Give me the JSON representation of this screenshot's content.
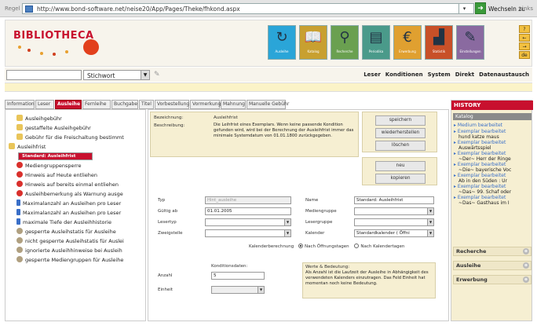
{
  "addressbar": {
    "label": "Regel",
    "url": "http://www.bond-software.net/neise20/App/Pages/Theke/fhkond.aspx",
    "go_label": "Wechseln zu",
    "links_label": "Links"
  },
  "header": {
    "logo_text": "BIBLIOTHECA",
    "toolbar_icons": [
      {
        "name": "refresh-icon",
        "glyph": "↻",
        "color": "#2aa5d8",
        "caption": "Ausleihe"
      },
      {
        "name": "book-icon",
        "glyph": "📖",
        "color": "#c8a030",
        "caption": "Katalog"
      },
      {
        "name": "search-icon",
        "glyph": "⚲",
        "color": "#6aa050",
        "caption": "Recherche"
      },
      {
        "name": "newspaper-icon",
        "glyph": "▤",
        "color": "#4a9a8a",
        "caption": "Periodika"
      },
      {
        "name": "euro-icon",
        "glyph": "€",
        "color": "#e0a030",
        "caption": "Erwerbung"
      },
      {
        "name": "chart-icon",
        "glyph": "▟",
        "color": "#c85028",
        "caption": "Statistik"
      },
      {
        "name": "wrench-icon",
        "glyph": "✎",
        "color": "#8a6aa0",
        "caption": "Einstellungen"
      }
    ],
    "right_mini": [
      "?",
      "←",
      "→",
      "de"
    ]
  },
  "search": {
    "select_value": "Stichwort",
    "input_value": ""
  },
  "menu": [
    "Leser",
    "Konditionen",
    "System",
    "Direkt",
    "Datenaustausch"
  ],
  "tabs": [
    "Information",
    "Leser",
    "Ausleihe",
    "Fernleihe",
    "Buchgabe",
    "Titel",
    "Vorbestellung",
    "Vormerkung",
    "Mahnung",
    "Manuelle Gebühr"
  ],
  "tree": [
    {
      "label": "Ausleihgebühr",
      "icon": "fold",
      "indent": 14
    },
    {
      "label": "gestaffelte Ausleihgebühr",
      "icon": "fold",
      "indent": 14
    },
    {
      "label": "Gebühr für die Freischaltung bestimmt",
      "icon": "fold",
      "indent": 14
    },
    {
      "label": "Ausleihfrist",
      "icon": "fold",
      "indent": 4
    },
    {
      "label": "Standard: Ausleihfrist",
      "icon": "",
      "indent": 22,
      "selected": true
    },
    {
      "label": "Mediengruppensperre",
      "icon": "red",
      "indent": 14
    },
    {
      "label": "Hinweis auf Heute entliehen",
      "icon": "red",
      "indent": 14
    },
    {
      "label": "Hinweis auf bereits einmal entliehen",
      "icon": "red",
      "indent": 14
    },
    {
      "label": "Ausleihbemerkung als Warnung ausge",
      "icon": "red",
      "indent": 14
    },
    {
      "label": "Maximalanzahl an Ausleihen pro Leser",
      "icon": "blue",
      "indent": 14
    },
    {
      "label": "Maximalanzahl an Ausleihen pro Leser",
      "icon": "blue",
      "indent": 14
    },
    {
      "label": "maximale Tiefe der Ausleihhistorie",
      "icon": "blue",
      "indent": 14
    },
    {
      "label": "gesperrte Ausleihstatis für Ausleihe",
      "icon": "gear",
      "indent": 14
    },
    {
      "label": "nicht gesperrte Ausleihstatis für Auslei",
      "icon": "gear",
      "indent": 14
    },
    {
      "label": "ignorierte Ausleihhinweise bei Ausleih",
      "icon": "gear",
      "indent": 14
    },
    {
      "label": "gesperrte Mediengruppen für Ausleihe",
      "icon": "gear",
      "indent": 14
    }
  ],
  "detail": {
    "bezeichnung_label": "Bezeichnung:",
    "bezeichnung_value": "Ausleihfrist",
    "beschreibung_label": "Beschreibung:",
    "beschreibung_value": "Die Leihfrist eines Exemplars. Wenn keine passende Kondition gefunden wird, wird bei der Berechnung der Ausleihfrist immer das minimale Systemdatum von 01.01.1800 zurückgegeben.",
    "buttons1": [
      "speichern",
      "wiederherstellen",
      "löschen"
    ],
    "buttons2": [
      "neu",
      "kopieren"
    ],
    "typ_label": "Typ",
    "typ_value": "Hint_ausleihe",
    "gueltig_label": "Gültig ab",
    "gueltig_value": "01.01.2005",
    "lesertyp_label": "Lesertyp",
    "zweigstelle_label": "Zweigstelle",
    "name_label": "Name",
    "name_value": "Standard: Ausleihfrist",
    "mediengruppe_label": "Mediengruppe",
    "lesergruppe_label": "Lesergruppe",
    "kalender_label": "Kalender",
    "kalender_value": "Standardkalender ( Öffni",
    "kalenderberechnung_label": "Kalenderberechnung",
    "radio1": "Nach Öffnungstagen",
    "radio2": "Nach Kalendertagen",
    "konditionsdaten_label": "Konditionsdaten:",
    "anzahl_label": "Anzahl",
    "anzahl_value": "5",
    "einheit_label": "Einheit",
    "einheit_value": "",
    "werte_title": "Werte & Bedeutung:",
    "werte_text": "Als Anzahl ist die Laufzeit der Ausleihe in Abhängigkeit des verwendeten Kalenders einzutragen. Das Feld Einheit hat momentan noch keine Bedeutung."
  },
  "history": {
    "title": "HISTORY",
    "sub": "Katalog",
    "items": [
      {
        "b": "▸ Medium bearbeitet",
        "t": ""
      },
      {
        "b": "▸ Exemplar bearbeitet",
        "t": "hund katze maus"
      },
      {
        "b": "▸ Exemplar bearbeitet",
        "t": "Auswärtsspiel"
      },
      {
        "b": "▸ Exemplar bearbeitet",
        "t": "~Der~ Herr der Ringe"
      },
      {
        "b": "▸ Exemplar bearbeitet",
        "t": "~Die~ bayerische Voc"
      },
      {
        "b": "▸ Exemplar bearbeitet",
        "t": "Ab in den Süden : Ur"
      },
      {
        "b": "▸ Exemplar bearbeitet",
        "t": "~Das~ 99. Schaf oder"
      },
      {
        "b": "▸ Exemplar bearbeitet",
        "t": "~Das~ Gasthaus im I"
      }
    ],
    "sections": [
      "Recherche",
      "Ausleihe",
      "Erwerbung"
    ]
  }
}
